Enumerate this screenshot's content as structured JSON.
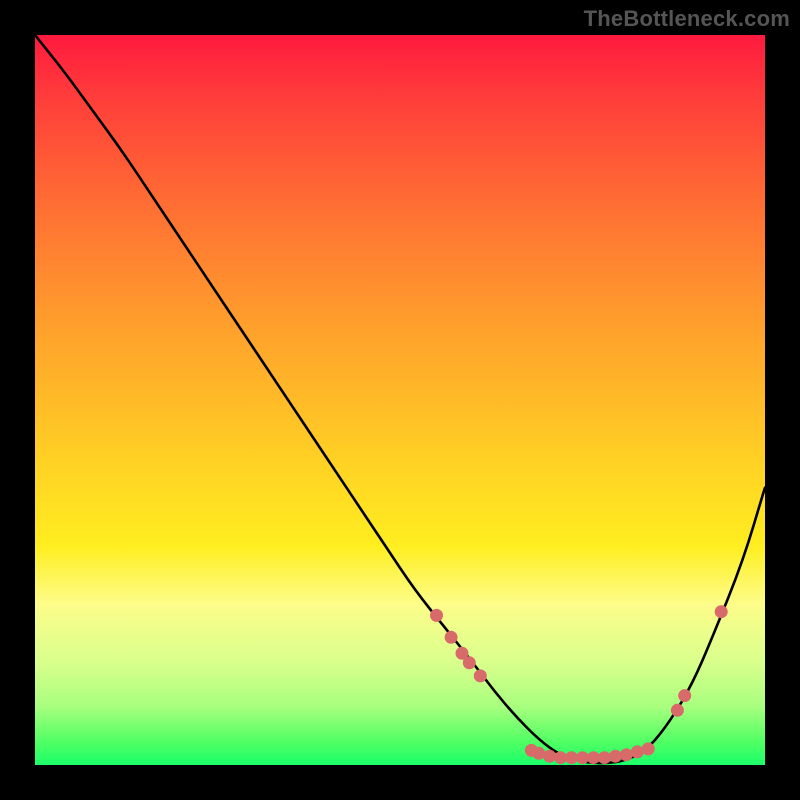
{
  "watermark": "TheBottleneck.com",
  "colors": {
    "background": "#000000",
    "curve": "#000000",
    "marker_fill": "#d86a6a",
    "marker_stroke": "#a64a4a",
    "gradient_top": "#ff1a3e",
    "gradient_mid": "#ffee20",
    "gradient_bottom": "#1aff6a"
  },
  "chart_data": {
    "type": "line",
    "title": "",
    "xlabel": "",
    "ylabel": "",
    "xlim": [
      0,
      100
    ],
    "ylim": [
      0,
      100
    ],
    "grid": false,
    "series": [
      {
        "name": "bottleneck_curve",
        "x": [
          0,
          4,
          8,
          12,
          16,
          20,
          24,
          28,
          32,
          36,
          40,
          44,
          48,
          52,
          56,
          60,
          63,
          66,
          69,
          72,
          75,
          78,
          81,
          84,
          87,
          90,
          93,
          97,
          100
        ],
        "y": [
          100,
          95,
          89.5,
          84,
          78,
          72,
          66,
          60,
          54,
          48,
          42,
          36,
          30,
          24,
          19,
          14,
          10,
          6.5,
          3.5,
          1.3,
          0.4,
          0.2,
          0.6,
          2.2,
          6,
          11,
          18,
          28,
          38
        ]
      }
    ],
    "markers": [
      {
        "x": 55,
        "y": 20.5
      },
      {
        "x": 57,
        "y": 17.5
      },
      {
        "x": 58.5,
        "y": 15.3
      },
      {
        "x": 59.5,
        "y": 14.0
      },
      {
        "x": 61,
        "y": 12.2
      },
      {
        "x": 68,
        "y": 2.0
      },
      {
        "x": 69,
        "y": 1.6
      },
      {
        "x": 70.5,
        "y": 1.2
      },
      {
        "x": 72,
        "y": 1.0
      },
      {
        "x": 73.5,
        "y": 1.0
      },
      {
        "x": 75,
        "y": 1.0
      },
      {
        "x": 76.5,
        "y": 1.0
      },
      {
        "x": 78,
        "y": 1.0
      },
      {
        "x": 79.5,
        "y": 1.2
      },
      {
        "x": 81,
        "y": 1.4
      },
      {
        "x": 82.5,
        "y": 1.8
      },
      {
        "x": 84,
        "y": 2.2
      },
      {
        "x": 88,
        "y": 7.5
      },
      {
        "x": 89,
        "y": 9.5
      },
      {
        "x": 94,
        "y": 21
      }
    ]
  }
}
